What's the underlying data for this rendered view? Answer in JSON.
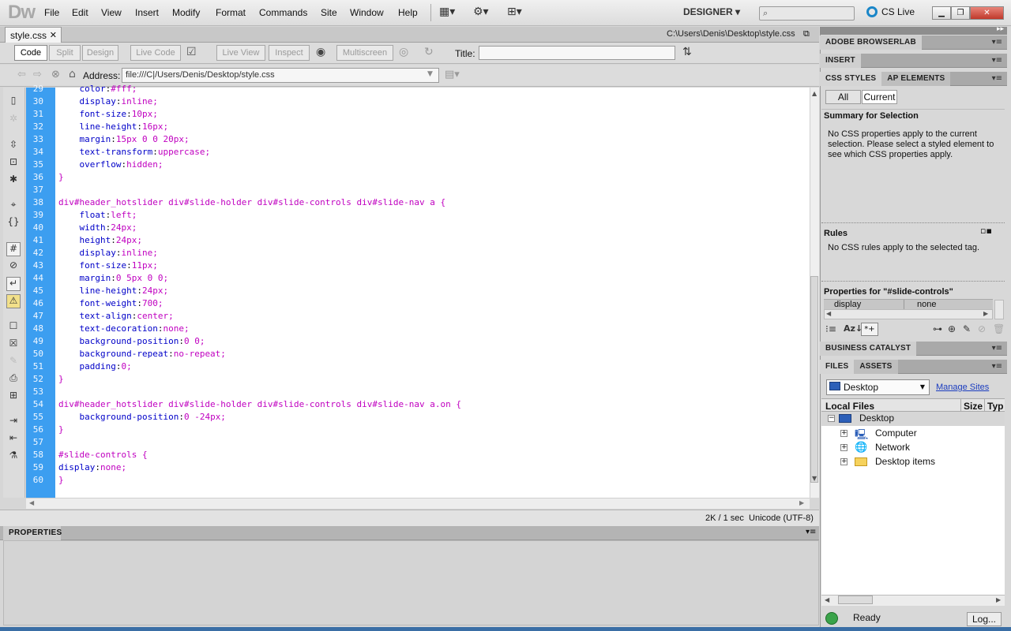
{
  "app": {
    "logo": "Dw",
    "menus": [
      "File",
      "Edit",
      "View",
      "Insert",
      "Modify",
      "Format",
      "Commands",
      "Site",
      "Window",
      "Help"
    ],
    "workspace": "DESIGNER",
    "cs_live": "CS Live"
  },
  "document": {
    "tab_name": "style.css",
    "path": "C:\\Users\\Denis\\Desktop\\style.css"
  },
  "doc_toolbar": {
    "views": [
      "Code",
      "Split",
      "Design",
      "Live Code"
    ],
    "live": [
      "Live View",
      "Inspect",
      "Multiscreen"
    ],
    "title_label": "Title:",
    "title_value": ""
  },
  "address": {
    "label": "Address:",
    "value": "file:///C|/Users/Denis/Desktop/style.css"
  },
  "code_lines": [
    {
      "n": "29",
      "text": "    color:#fff;",
      "kind": "prop"
    },
    {
      "n": "30",
      "text": "    display:inline;",
      "kind": "prop"
    },
    {
      "n": "31",
      "text": "    font-size:10px;",
      "kind": "prop"
    },
    {
      "n": "32",
      "text": "    line-height:16px;",
      "kind": "prop"
    },
    {
      "n": "33",
      "text": "    margin:15px 0 0 20px;",
      "kind": "prop"
    },
    {
      "n": "34",
      "text": "    text-transform:uppercase;",
      "kind": "prop"
    },
    {
      "n": "35",
      "text": "    overflow:hidden;",
      "kind": "prop"
    },
    {
      "n": "36",
      "text": "}",
      "kind": "brace"
    },
    {
      "n": "37",
      "text": "",
      "kind": "blank"
    },
    {
      "n": "38",
      "text": "div#header_hotslider div#slide-holder div#slide-controls div#slide-nav a {",
      "kind": "sel"
    },
    {
      "n": "39",
      "text": "    float:left;",
      "kind": "prop"
    },
    {
      "n": "40",
      "text": "    width:24px;",
      "kind": "prop"
    },
    {
      "n": "41",
      "text": "    height:24px;",
      "kind": "prop"
    },
    {
      "n": "42",
      "text": "    display:inline;",
      "kind": "prop"
    },
    {
      "n": "43",
      "text": "    font-size:11px;",
      "kind": "prop"
    },
    {
      "n": "44",
      "text": "    margin:0 5px 0 0;",
      "kind": "prop"
    },
    {
      "n": "45",
      "text": "    line-height:24px;",
      "kind": "prop"
    },
    {
      "n": "46",
      "text": "    font-weight:700;",
      "kind": "prop"
    },
    {
      "n": "47",
      "text": "    text-align:center;",
      "kind": "prop"
    },
    {
      "n": "48",
      "text": "    text-decoration:none;",
      "kind": "prop"
    },
    {
      "n": "49",
      "text": "    background-position:0 0;",
      "kind": "prop"
    },
    {
      "n": "50",
      "text": "    background-repeat:no-repeat;",
      "kind": "prop"
    },
    {
      "n": "51",
      "text": "    padding:0;",
      "kind": "prop"
    },
    {
      "n": "52",
      "text": "}",
      "kind": "brace"
    },
    {
      "n": "53",
      "text": "",
      "kind": "blank"
    },
    {
      "n": "54",
      "text": "div#header_hotslider div#slide-holder div#slide-controls div#slide-nav a.on {",
      "kind": "sel"
    },
    {
      "n": "55",
      "text": "    background-position:0 -24px;",
      "kind": "prop"
    },
    {
      "n": "56",
      "text": "}",
      "kind": "brace"
    },
    {
      "n": "57",
      "text": "",
      "kind": "blank"
    },
    {
      "n": "58",
      "text": "#slide-controls {",
      "kind": "sel"
    },
    {
      "n": "59",
      "text": "display:none;",
      "kind": "prop"
    },
    {
      "n": "60",
      "text": "}",
      "kind": "brace"
    }
  ],
  "status": {
    "size_time": "2K / 1 sec",
    "encoding": "Unicode (UTF-8)"
  },
  "properties_panel": {
    "title": "PROPERTIES"
  },
  "right": {
    "browserlab": "ADOBE BROWSERLAB",
    "insert": "INSERT",
    "css_tabs": [
      "CSS STYLES",
      "AP ELEMENTS"
    ],
    "mode_all": "All",
    "mode_current": "Current",
    "summary_title": "Summary for Selection",
    "summary_text": "No CSS properties apply to the current selection.  Please select a styled element to see which CSS properties apply.",
    "rules_title": "Rules",
    "rules_text": "No CSS rules apply to the selected tag.",
    "props_for": "Properties for \"#slide-controls\"",
    "prop_name": "display",
    "prop_value": "none",
    "bc_title": "BUSINESS CATALYST",
    "files_tabs": [
      "FILES",
      "ASSETS"
    ],
    "site_select": "Desktop",
    "manage_sites": "Manage Sites",
    "col_local": "Local Files",
    "col_size": "Size",
    "col_type": "Typ",
    "tree_root": "Desktop",
    "tree_children": [
      "Computer",
      "Network",
      "Desktop items"
    ],
    "ready": "Ready",
    "log_button": "Log..."
  }
}
